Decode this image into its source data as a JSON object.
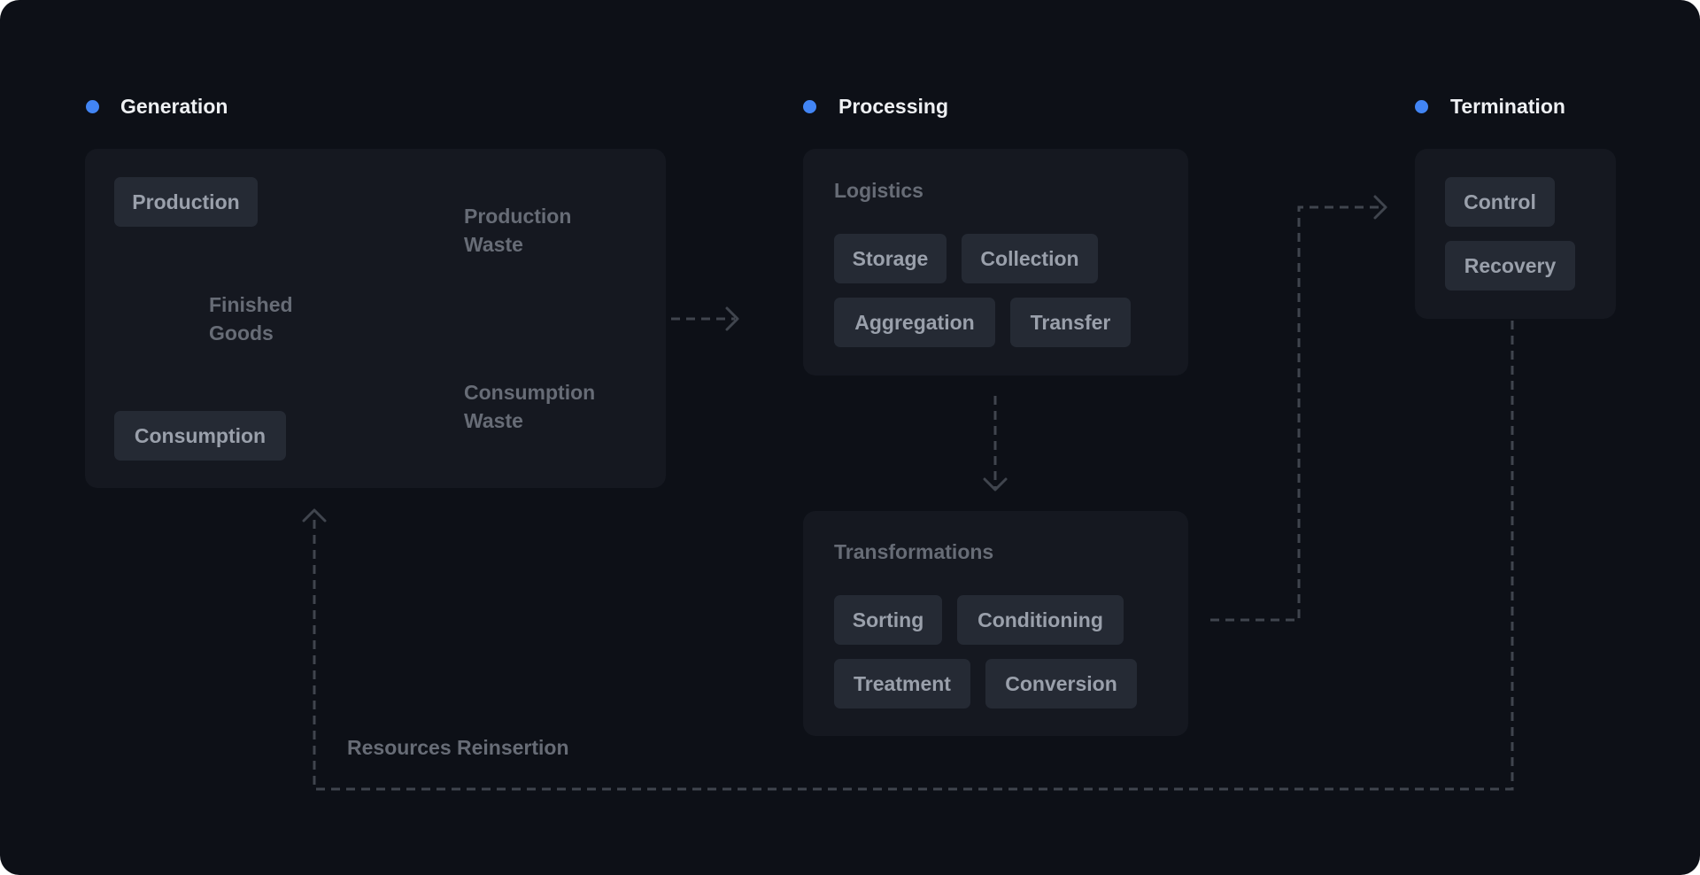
{
  "colors": {
    "background": "#0d1017",
    "panel": "#151820",
    "chip": "#252a34",
    "accent": "#4285f4",
    "connector": "#40454e"
  },
  "stages": [
    {
      "title": "Generation",
      "nodes": [
        "Production",
        "Consumption"
      ],
      "edges": {
        "finished_goods": [
          "Finished",
          "Goods"
        ],
        "production_waste": [
          "Production",
          "Waste"
        ],
        "consumption_waste": [
          "Consumption",
          "Waste"
        ]
      }
    },
    {
      "title": "Processing",
      "groups": [
        {
          "title": "Logistics",
          "nodes": [
            "Storage",
            "Collection",
            "Aggregation",
            "Transfer"
          ]
        },
        {
          "title": "Transformations",
          "nodes": [
            "Sorting",
            "Conditioning",
            "Treatment",
            "Conversion"
          ]
        }
      ]
    },
    {
      "title": "Termination",
      "nodes": [
        "Control",
        "Recovery"
      ]
    }
  ],
  "feedback_label": "Resources Reinsertion"
}
